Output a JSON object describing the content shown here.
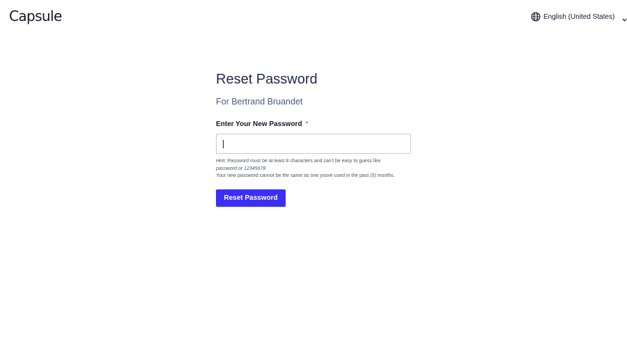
{
  "header": {
    "logo_text": "Capsule",
    "language": {
      "label": "English (United States)",
      "globe_icon": "globe-icon",
      "chevron_icon": "chevron-down-icon"
    }
  },
  "form": {
    "title": "Reset Password",
    "subtitle": "For Bertrand Bruandet",
    "field_label": "Enter Your New Password",
    "required_marker": "*",
    "password_value": "",
    "hint": {
      "prefix": "Hint: Password must be at least 8 characters and can't be easy to guess like",
      "example_1": "password",
      "connector": "or",
      "example_2": "12345678",
      "line_2": "Your new password cannot be the same as one youve used in the past (0) months."
    },
    "submit_label": "Reset Password"
  },
  "colors": {
    "primary_button": "#3a2ff5",
    "required_marker": "#d14b2a",
    "title": "#1e2a4a"
  }
}
